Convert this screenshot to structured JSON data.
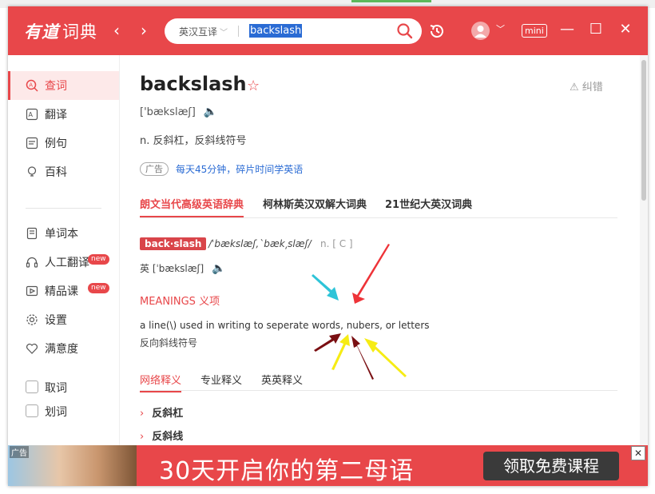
{
  "app": {
    "logo_brand": "有道",
    "logo_name": "词典",
    "back_icon": "‹",
    "forward_icon": "›",
    "mini_label": "mini",
    "minimize_icon": "—",
    "maximize_icon": "☐",
    "close_icon": "✕"
  },
  "search": {
    "language": "英汉互译",
    "query": "backslash"
  },
  "sidebar": {
    "items": [
      {
        "label": "查词"
      },
      {
        "label": "翻译"
      },
      {
        "label": "例句"
      },
      {
        "label": "百科"
      },
      {
        "label": "单词本"
      },
      {
        "label": "人工翻译",
        "badge": "new"
      },
      {
        "label": "精品课",
        "badge": "new"
      },
      {
        "label": "设置"
      },
      {
        "label": "满意度"
      }
    ],
    "checkboxes": [
      {
        "label": "取词"
      },
      {
        "label": "划词"
      }
    ]
  },
  "entry": {
    "word": "backslash",
    "report_label": "纠错",
    "phonetic": "['bækslæʃ]",
    "definition": "n. 反斜杠，反斜线符号",
    "ad_tag": "广告",
    "ad_text": "每天45分钟，碎片时间学英语",
    "dict_tabs": [
      "朗文当代高级英语辞典",
      "柯林斯英汉双解大词典",
      "21世纪大英汉词典"
    ],
    "headword": "back·slash",
    "headword_ipa": "/ˈbækslæʃ,ˋbæk͵slæʃ/",
    "headword_pos": "n. [ C ]",
    "uk_phonetic": "英 [ˈbækslæʃ]",
    "meanings_title": "MEANINGS 义项",
    "meaning_en": "a line(\\) used in writing to seperate words, nubers, or letters",
    "meaning_cn": "反向斜线符号",
    "sub_tabs": [
      "网络释义",
      "专业释义",
      "英英释义"
    ],
    "translations": [
      "反斜杠",
      "反斜线"
    ]
  },
  "banner": {
    "tag": "广告",
    "title": "30天开启你的第二母语",
    "button": "领取免费课程",
    "close": "✕"
  },
  "colors": {
    "accent": "#e8474a",
    "link": "#2a6bd4"
  }
}
